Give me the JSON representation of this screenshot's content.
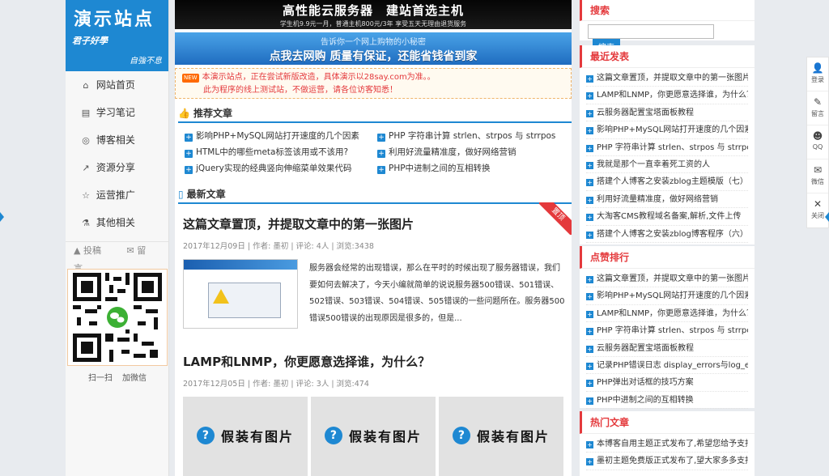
{
  "logo": {
    "title": "演示站点",
    "slogan1": "君子好學",
    "slogan2": "自強不息"
  },
  "nav": [
    {
      "label": "网站首页",
      "icon": "home-icon",
      "glyph": "⌂"
    },
    {
      "label": "学习笔记",
      "icon": "book-icon",
      "glyph": "▤"
    },
    {
      "label": "博客相关",
      "icon": "lifebuoy-icon",
      "glyph": "◎"
    },
    {
      "label": "资源分享",
      "icon": "share-icon",
      "glyph": "↗"
    },
    {
      "label": "运营推广",
      "icon": "star-icon",
      "glyph": "☆"
    },
    {
      "label": "其他相关",
      "icon": "flask-icon",
      "glyph": "⚗"
    }
  ],
  "sub_links": {
    "submit": "投稿",
    "message": "留言"
  },
  "qr_caption": {
    "scan": "扫一扫",
    "add": "加微信"
  },
  "banners": {
    "b1_title": "高性能云服务器　建站首选主机",
    "b1_sub": "学生机9.9元一月，普通主机800元/3年 享受五天无理由退货服务",
    "b2_top": "告诉你一个网上购物的小秘密",
    "b2_main": "点我去网购 质量有保证，还能省钱省到家"
  },
  "notice": {
    "badge": "NEW",
    "line1": "本演示站点，正在尝试新版改造，具体演示以28say.com为准。。",
    "line2": "此为程序的线上测试站，不做运营，请各位访客知悉！"
  },
  "recommend": {
    "title": "推荐文章",
    "items": [
      "影响PHP+MySQL网站打开速度的几个因素",
      "PHP 字符串计算 strlen、strpos 与 strrpos",
      "HTML中的哪些meta标签该用或不该用?",
      "利用好流量精准度，做好网络营销",
      "jQuery实现的经典竖向伸缩菜单效果代码",
      "PHP中进制之间的互相转换"
    ]
  },
  "latest": {
    "title": "最新文章"
  },
  "posts": [
    {
      "title": "这篇文章置顶，并提取文章中的第一张图片",
      "meta": "2017年12月09日 | 作者: 墨初 | 评论: 4人 | 浏览:3438",
      "ribbon": "置顶",
      "excerpt": "服务器会经常的出现错误，那么在平时的时候出现了服务器错误，我们要如何去解决了，今天小编就简单的说说服务器500错误、501错误、502错误、503错误、504错误、505错误的一些问题所在。服务器500错误500错误的出现原因是很多的，但是..."
    },
    {
      "title": "LAMP和LNMP，你更愿意选择谁，为什么？",
      "meta": "2017年12月05日 | 作者: 墨初 | 评论: 3人 | 浏览:474",
      "placeholder": "假装有图片"
    }
  ],
  "search": {
    "title": "搜索",
    "placeholder": "",
    "button": "搜索"
  },
  "recent": {
    "title": "最近发表",
    "items": [
      "这篇文章置顶，并提取文章中的第一张图片",
      "LAMP和LNMP，你更愿意选择谁，为什么？",
      "云服务器配置宝塔面板教程",
      "影响PHP+MySQL网站打开速度的几个因素",
      "PHP 字符串计算 strlen、strpos 与 strrpos",
      "我就是那个一直幸着死工资的人",
      "搭建个人博客之安装zblog主题模版（七）",
      "利用好流量精准度，做好网络营销",
      "大淘客CMS教程域名备案,解析,文件上传",
      "搭建个人博客之安装zblog博客程序（六）"
    ]
  },
  "popular": {
    "title": "点赞排行",
    "items": [
      "这篇文章置顶，并提取文章中的第一张图片",
      "影响PHP+MySQL网站打开速度的几个因素",
      "LAMP和LNMP，你更愿意选择谁，为什么？",
      "PHP 字符串计算 strlen、strpos 与 strrpos",
      "云服务器配置宝塔面板教程",
      "记录PHP错误日志 display_errors与log_errors",
      "PHP弹出对话框的技巧方案",
      "PHP中进制之间的互相转换"
    ]
  },
  "hot": {
    "title": "热门文章",
    "items": [
      "本博客自用主题正式发布了,希望您给予支持",
      "墨初主题免费版正式发布了,望大家多多支持"
    ]
  },
  "float_bar": [
    {
      "label": "登录",
      "icon": "user-icon",
      "glyph": "👤"
    },
    {
      "label": "留言",
      "icon": "edit-icon",
      "glyph": "✎"
    },
    {
      "label": "QQ",
      "icon": "qq-icon",
      "glyph": "☻"
    },
    {
      "label": "微信",
      "icon": "wechat-icon",
      "glyph": "✉"
    },
    {
      "label": "关闭",
      "icon": "close-icon",
      "glyph": "✕"
    }
  ],
  "colors": {
    "accent": "#1e88d2",
    "red": "#e4393c",
    "page_bg": "#e8ebef"
  }
}
